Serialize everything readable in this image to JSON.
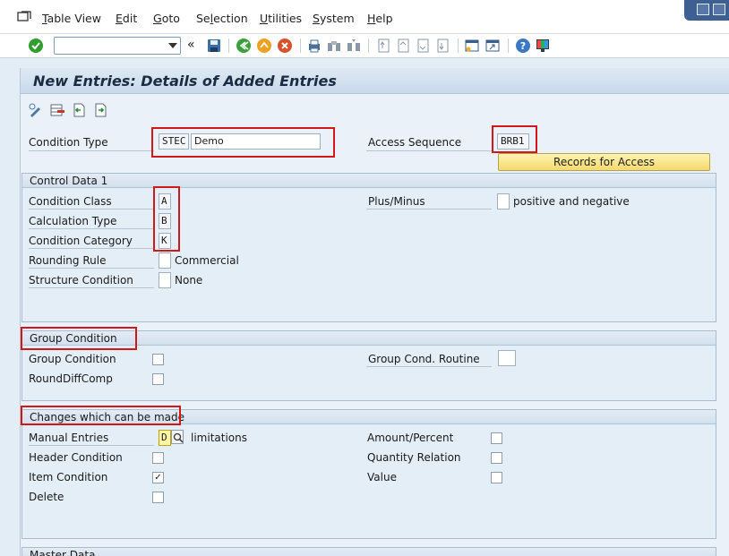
{
  "menu": {
    "items": [
      {
        "label": "Table View",
        "key": "T"
      },
      {
        "label": "Edit",
        "key": "E"
      },
      {
        "label": "Goto",
        "key": "G"
      },
      {
        "label": "Selection",
        "key": "l"
      },
      {
        "label": "Utilities",
        "key": "U"
      },
      {
        "label": "System",
        "key": "S"
      },
      {
        "label": "Help",
        "key": "H"
      }
    ]
  },
  "toolbar": {
    "command_value": "",
    "prev_label": "«",
    "icons": [
      "enter-icon",
      "save-icon",
      "back-icon",
      "exit-icon",
      "cancel-icon",
      "print-icon",
      "find-icon",
      "find-next-icon",
      "first-page-icon",
      "prev-page-icon",
      "next-page-icon",
      "last-page-icon",
      "create-session-icon",
      "shortcut-icon",
      "help-icon",
      "customize-layout-icon"
    ]
  },
  "page": {
    "title": "New Entries: Details of Added Entries"
  },
  "header": {
    "condition_type_label": "Condition Type",
    "condition_type_value": "STEC",
    "condition_type_desc": "Demo",
    "access_sequence_label": "Access Sequence",
    "access_sequence_value": "BRB1",
    "records_button": "Records for Access"
  },
  "control_data": {
    "title": "Control Data 1",
    "condition_class_label": "Condition Class",
    "condition_class_value": "A",
    "calculation_type_label": "Calculation Type",
    "calculation_type_value": "B",
    "condition_category_label": "Condition Category",
    "condition_category_value": "K",
    "rounding_rule_label": "Rounding Rule",
    "rounding_rule_value": "",
    "rounding_rule_desc": "Commercial",
    "structure_condition_label": "Structure Condition",
    "structure_condition_value": "",
    "structure_condition_desc": "None",
    "plus_minus_label": "Plus/Minus",
    "plus_minus_value": "",
    "plus_minus_desc": "positive and negative"
  },
  "group_condition": {
    "title": "Group Condition",
    "group_condition_label": "Group Condition",
    "group_condition_checked": false,
    "rounddiff_label": "RoundDiffComp",
    "rounddiff_checked": false,
    "routine_label": "Group Cond. Routine",
    "routine_value": ""
  },
  "changes": {
    "title": "Changes which can be made",
    "manual_entries_label": "Manual Entries",
    "manual_entries_value": "D",
    "manual_entries_desc": "limitations",
    "header_condition_label": "Header Condition",
    "header_condition_checked": false,
    "item_condition_label": "Item Condition",
    "item_condition_checked": true,
    "item_condition_mark": "✓",
    "delete_label": "Delete",
    "delete_checked": false,
    "amount_percent_label": "Amount/Percent",
    "amount_percent_checked": false,
    "quantity_relation_label": "Quantity Relation",
    "quantity_relation_checked": false,
    "value_label": "Value",
    "value_checked": false
  },
  "master_data": {
    "title": "Master Data"
  },
  "colors": {
    "highlight_box": "#d21818",
    "button_yellow": "#f5d96e",
    "panel_bg": "#e4eef7"
  }
}
